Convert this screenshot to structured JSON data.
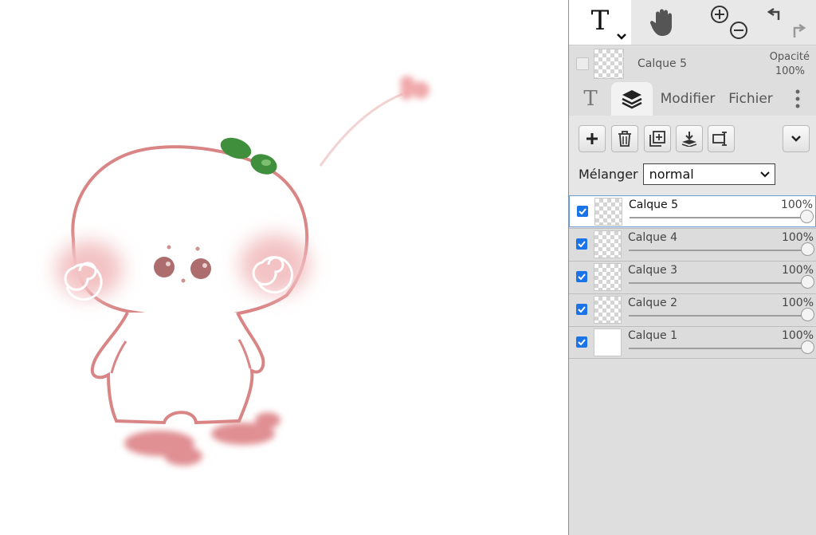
{
  "canvas": {
    "description_icon": "drawing-canvas"
  },
  "tools": {
    "text_tool": "T",
    "icons": [
      "text-tool-icon",
      "hand-tool-icon",
      "zoom-in-icon",
      "zoom-out-icon",
      "undo-icon",
      "redo-icon"
    ]
  },
  "current_layer": {
    "name": "Calque 5",
    "opacity_label": "Opacité",
    "opacity_value": "100%"
  },
  "tabs": {
    "text_tab": "T",
    "modify": "Modifier",
    "file": "Fichier"
  },
  "blend": {
    "label": "Mélanger",
    "value": "normal"
  },
  "layers": [
    {
      "name": "Calque 5",
      "opacity": "100%",
      "checked": true,
      "selected": true
    },
    {
      "name": "Calque 4",
      "opacity": "100%",
      "checked": true,
      "selected": false
    },
    {
      "name": "Calque 3",
      "opacity": "100%",
      "checked": true,
      "selected": false
    },
    {
      "name": "Calque 2",
      "opacity": "100%",
      "checked": true,
      "selected": false
    },
    {
      "name": "Calque 1",
      "opacity": "100%",
      "checked": true,
      "selected": false
    }
  ],
  "colors": {
    "accent": "#1a73e8",
    "panel_bg": "#dedede",
    "outline": "#d9807f",
    "leaf": "#3f8f3c",
    "blush": "#f4c6c6"
  }
}
